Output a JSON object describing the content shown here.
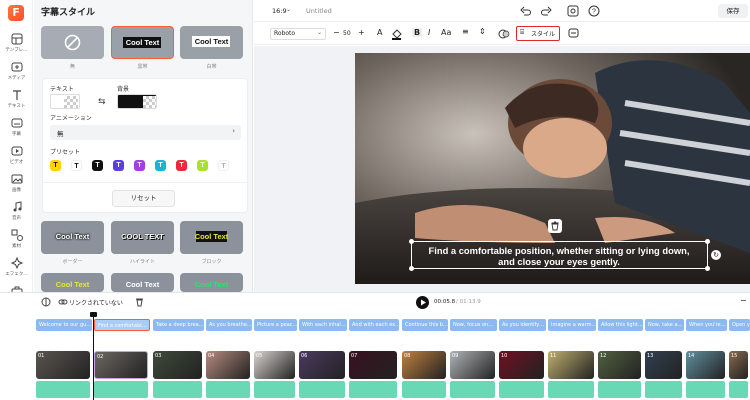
{
  "app": {
    "logo_letter": "F"
  },
  "rail": [
    {
      "label": "テンプレ…",
      "icon": "template-icon"
    },
    {
      "label": "メディア",
      "icon": "media-icon"
    },
    {
      "label": "テキスト",
      "icon": "text-icon"
    },
    {
      "label": "字幕",
      "icon": "subtitle-icon"
    },
    {
      "label": "ビデオ",
      "icon": "video-icon"
    },
    {
      "label": "画像",
      "icon": "image-icon"
    },
    {
      "label": "音声",
      "icon": "music-icon"
    },
    {
      "label": "素材",
      "icon": "elements-icon"
    },
    {
      "label": "エフェク…",
      "icon": "effects-icon"
    },
    {
      "label": "ツール",
      "icon": "tools-icon"
    }
  ],
  "panel": {
    "title": "字幕スタイル",
    "styles": [
      {
        "label": "無",
        "text": "",
        "selected": false
      },
      {
        "label": "黒帯",
        "text": "Cool Text",
        "selected": true
      },
      {
        "label": "白帯",
        "text": "Cool Text",
        "selected": false
      }
    ],
    "text_label": "テキスト",
    "bg_label": "背景",
    "animation_label": "アニメーション",
    "animation_value": "無",
    "presets_label": "プリセット",
    "presets": [
      {
        "glyph": "T",
        "bg": "#ffd400",
        "fg": "#111111"
      },
      {
        "glyph": "T",
        "bg": "#ffffff",
        "fg": "#111111"
      },
      {
        "glyph": "T",
        "bg": "#111111",
        "fg": "#ffffff"
      },
      {
        "glyph": "T",
        "bg": "#5b3de0",
        "fg": "#ffffff"
      },
      {
        "glyph": "T",
        "bg": "#a43ce8",
        "fg": "#ffffff"
      },
      {
        "glyph": "T",
        "bg": "#17b5d6",
        "fg": "#ffffff"
      },
      {
        "glyph": "T",
        "bg": "#f0263a",
        "fg": "#ffffff"
      },
      {
        "glyph": "T",
        "bg": "#a8e02c",
        "fg": "#ffffff"
      },
      {
        "glyph": "T",
        "bg": "#ffffff",
        "fg": "#ff8ca8"
      }
    ],
    "reset_label": "リセット",
    "effects": [
      {
        "label": "ボーダー",
        "text": "Cool Text"
      },
      {
        "label": "ハイライト",
        "text": "COOL TEXT"
      },
      {
        "label": "ブロック",
        "text": "Cool Text"
      }
    ],
    "more_effects": [
      {
        "text": "Cool Text"
      },
      {
        "text": "Cool Text"
      },
      {
        "text": "Cool Text"
      }
    ]
  },
  "topbar": {
    "aspect": "16:9",
    "title": "Untitled",
    "save_label": "保存"
  },
  "toolbar": {
    "font": "Roboto",
    "font_size": "50",
    "style_label": "スタイル"
  },
  "video": {
    "caption_line1": "Find a comfortable position, whether sitting or lying down,",
    "caption_line2": "and close your eyes gently."
  },
  "timeline": {
    "unlink_label": "リンクされていない",
    "current_time": "00:05.8",
    "total_time": "/ 01:13.9",
    "captions": [
      "Welcome to our gu…",
      "Find a comfortabl…",
      "Take a deep brea…",
      "As you breathe…",
      "Picture a peac…",
      "With each inhal…",
      "And with each ex…",
      "Continue this b…",
      "Now, focus on…",
      "As you identify…",
      "Imagine a warm…",
      "Allow this light…",
      "Now, take a…",
      "When you're…",
      "Open y…"
    ],
    "clips": [
      "01",
      "02",
      "03",
      "04",
      "05",
      "06",
      "07",
      "08",
      "09",
      "10",
      "11",
      "12",
      "13",
      "14",
      "15"
    ]
  },
  "colors": {
    "accent": "#ff5b3a",
    "selection": "#1aa3d8",
    "caption_chip": "#8cbaf0",
    "audio": "#69d9b5"
  }
}
